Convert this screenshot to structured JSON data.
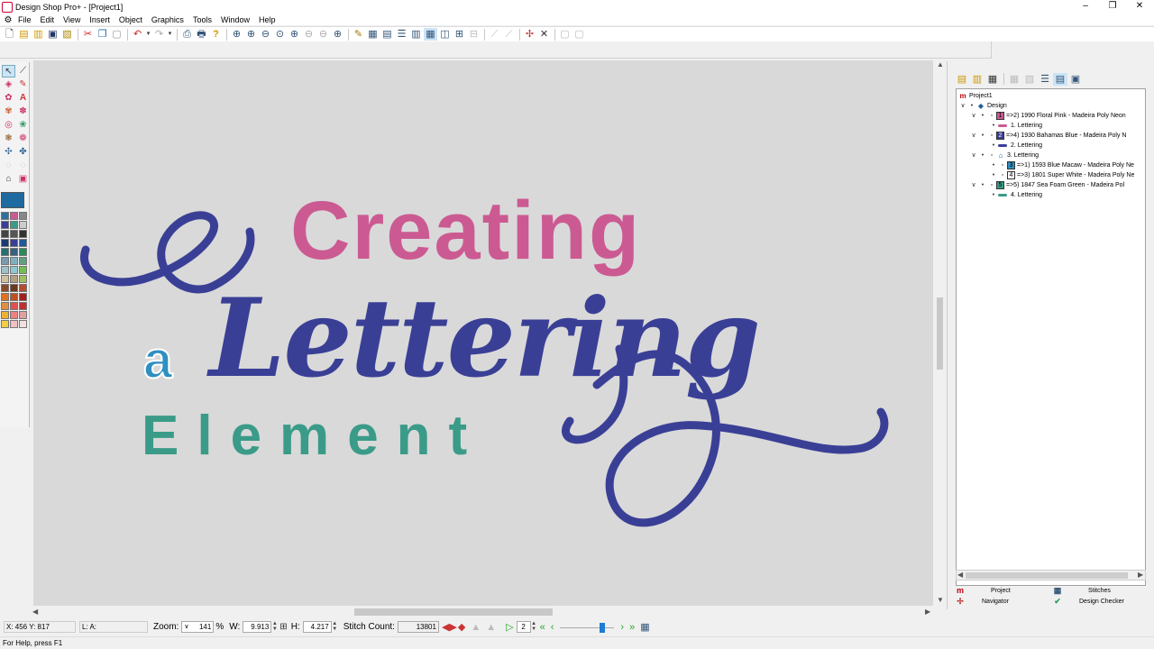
{
  "window": {
    "title": "Design Shop Pro+ - [Project1]",
    "controls": [
      "–",
      "❐",
      "✕"
    ]
  },
  "menu": {
    "items": [
      "File",
      "Edit",
      "View",
      "Insert",
      "Object",
      "Graphics",
      "Tools",
      "Window",
      "Help"
    ]
  },
  "canvas": {
    "words": {
      "top": "Creating",
      "middle": "Lettering",
      "small": "a",
      "bottom": "Element"
    },
    "colors": {
      "background": "#d9d9d9",
      "pink": "#cc5a92",
      "navy": "#3a3f96",
      "blue": "#2f8fc0",
      "green": "#3a9b88"
    }
  },
  "tree": {
    "rows": [
      {
        "text": "Project1",
        "icon": "m"
      },
      {
        "text": "Design"
      },
      {
        "text": "=>2) 1990 Floral Pink - Madeira Poly Neon",
        "chip": "1",
        "color": "#cc5a92"
      },
      {
        "text": "1. Lettering",
        "color": "#cc5a92"
      },
      {
        "text": "=>4) 1930 Bahamas Blue - Madeira Poly N",
        "chip": "2",
        "color": "#3a3f96"
      },
      {
        "text": "2. Lettering",
        "color": "#3a3f96"
      },
      {
        "text": "3. Lettering"
      },
      {
        "text": "=>1) 1593 Blue Macaw - Madeira Poly Ne",
        "chip": "3",
        "color": "#2f8fc0"
      },
      {
        "text": "=>3) 1801 Super White - Madeira Poly Ne",
        "chip": "4",
        "color": "#ffffff"
      },
      {
        "text": "=>5) 1847 Sea Foam Green - Madeira Pol",
        "chip": "5",
        "color": "#3a9b88"
      },
      {
        "text": "4. Lettering",
        "color": "#3a9b88"
      }
    ]
  },
  "panel_tabs": {
    "project": "Project",
    "stitches": "Stitches",
    "navigator": "Navigator",
    "design_checker": "Design Checker"
  },
  "infobar": {
    "coords": "X: 456  Y: 817",
    "la": "L: A:",
    "zoom_label": "Zoom:",
    "zoom_value": "141",
    "zoom_unit": "%",
    "w_label": "W:",
    "w_value": "9.913",
    "h_label": "H:",
    "h_value": "4.217",
    "stitch_label": "Stitch Count:",
    "stitch_value": "13801",
    "step_value": "2"
  },
  "status": {
    "text": "For Help, press F1"
  },
  "palette_colors": [
    "#2f6fa0",
    "#cc5a92",
    "#888888",
    "#3a3f96",
    "#3a9b88",
    "#cccccc",
    "#444444",
    "#555555",
    "#333333",
    "#1a3a70",
    "#3a3f96",
    "#1e5a9a",
    "#2a6f70",
    "#3a6080",
    "#2a8a5a",
    "#7a9ab0",
    "#80b0c0",
    "#60a080",
    "#a0c0c8",
    "#90c8d0",
    "#70c050",
    "#d0c0a0",
    "#b0a080",
    "#a0c060",
    "#8a4a2a",
    "#6a3a20",
    "#b05030",
    "#e07020",
    "#c05020",
    "#a02020",
    "#e09040",
    "#e05050",
    "#c03030",
    "#f0b030",
    "#f08080",
    "#e0a0a0",
    "#f0d040",
    "#f0c0c0",
    "#f0e0e0"
  ]
}
